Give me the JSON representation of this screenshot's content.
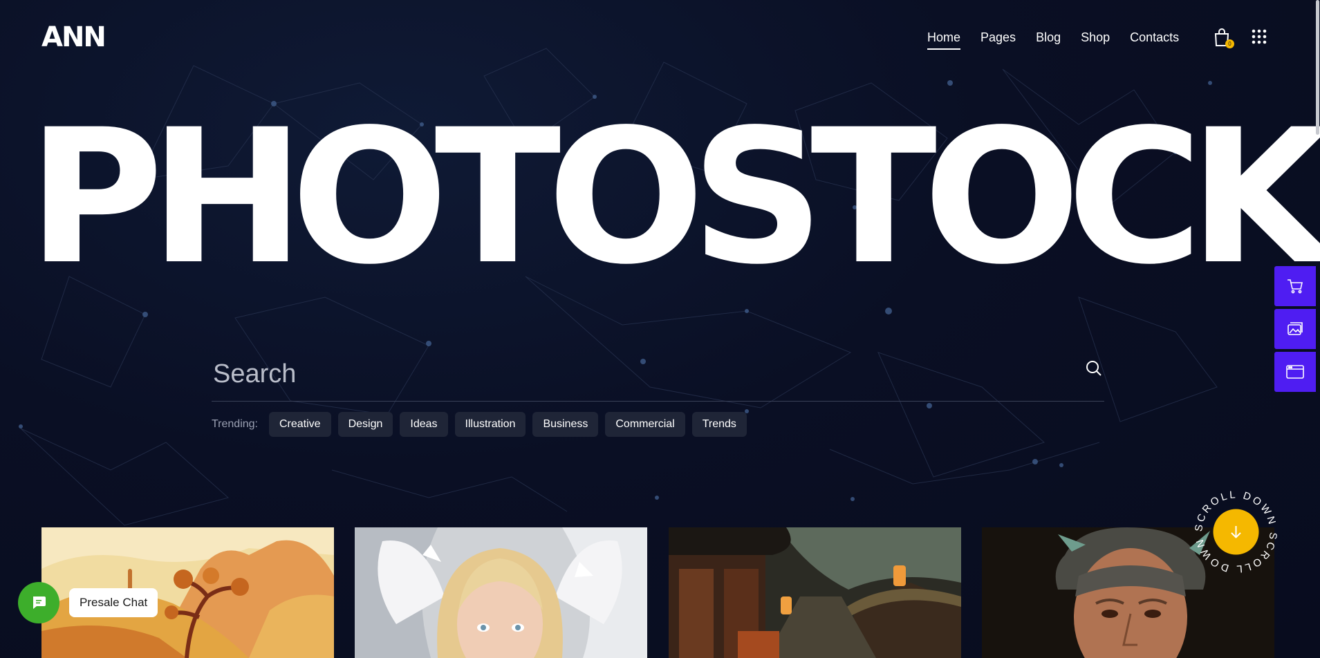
{
  "brand": {
    "logo_text": "ANN"
  },
  "nav": {
    "items": [
      {
        "label": "Home",
        "active": true
      },
      {
        "label": "Pages",
        "active": false
      },
      {
        "label": "Blog",
        "active": false
      },
      {
        "label": "Shop",
        "active": false
      },
      {
        "label": "Contacts",
        "active": false
      }
    ],
    "cart_count": "0",
    "cart_icon": "shopping-bag-icon",
    "menu_icon": "grid-menu-icon"
  },
  "hero": {
    "title": "PHOTOSTOCK",
    "search_placeholder": "Search",
    "trending_label": "Trending:",
    "trending_tags": [
      "Creative",
      "Design",
      "Ideas",
      "Illustration",
      "Business",
      "Commercial",
      "Trends"
    ]
  },
  "side_panel": {
    "icons": [
      "cart-icon",
      "gallery-icon",
      "browser-window-icon"
    ],
    "accent": "#4f1df2"
  },
  "scroll_down": {
    "text": "SCROLL DOWN SCROLL DOWN",
    "accent": "#f5b800"
  },
  "gallery": {
    "cards": [
      {
        "subject": "desert landscape with trees illustration"
      },
      {
        "subject": "blonde angel with white wings"
      },
      {
        "subject": "asian village street with lanterns"
      },
      {
        "subject": "portrait of a grey-haired man"
      }
    ]
  },
  "chat": {
    "label": "Presale Chat",
    "accent": "#3dae2b"
  }
}
